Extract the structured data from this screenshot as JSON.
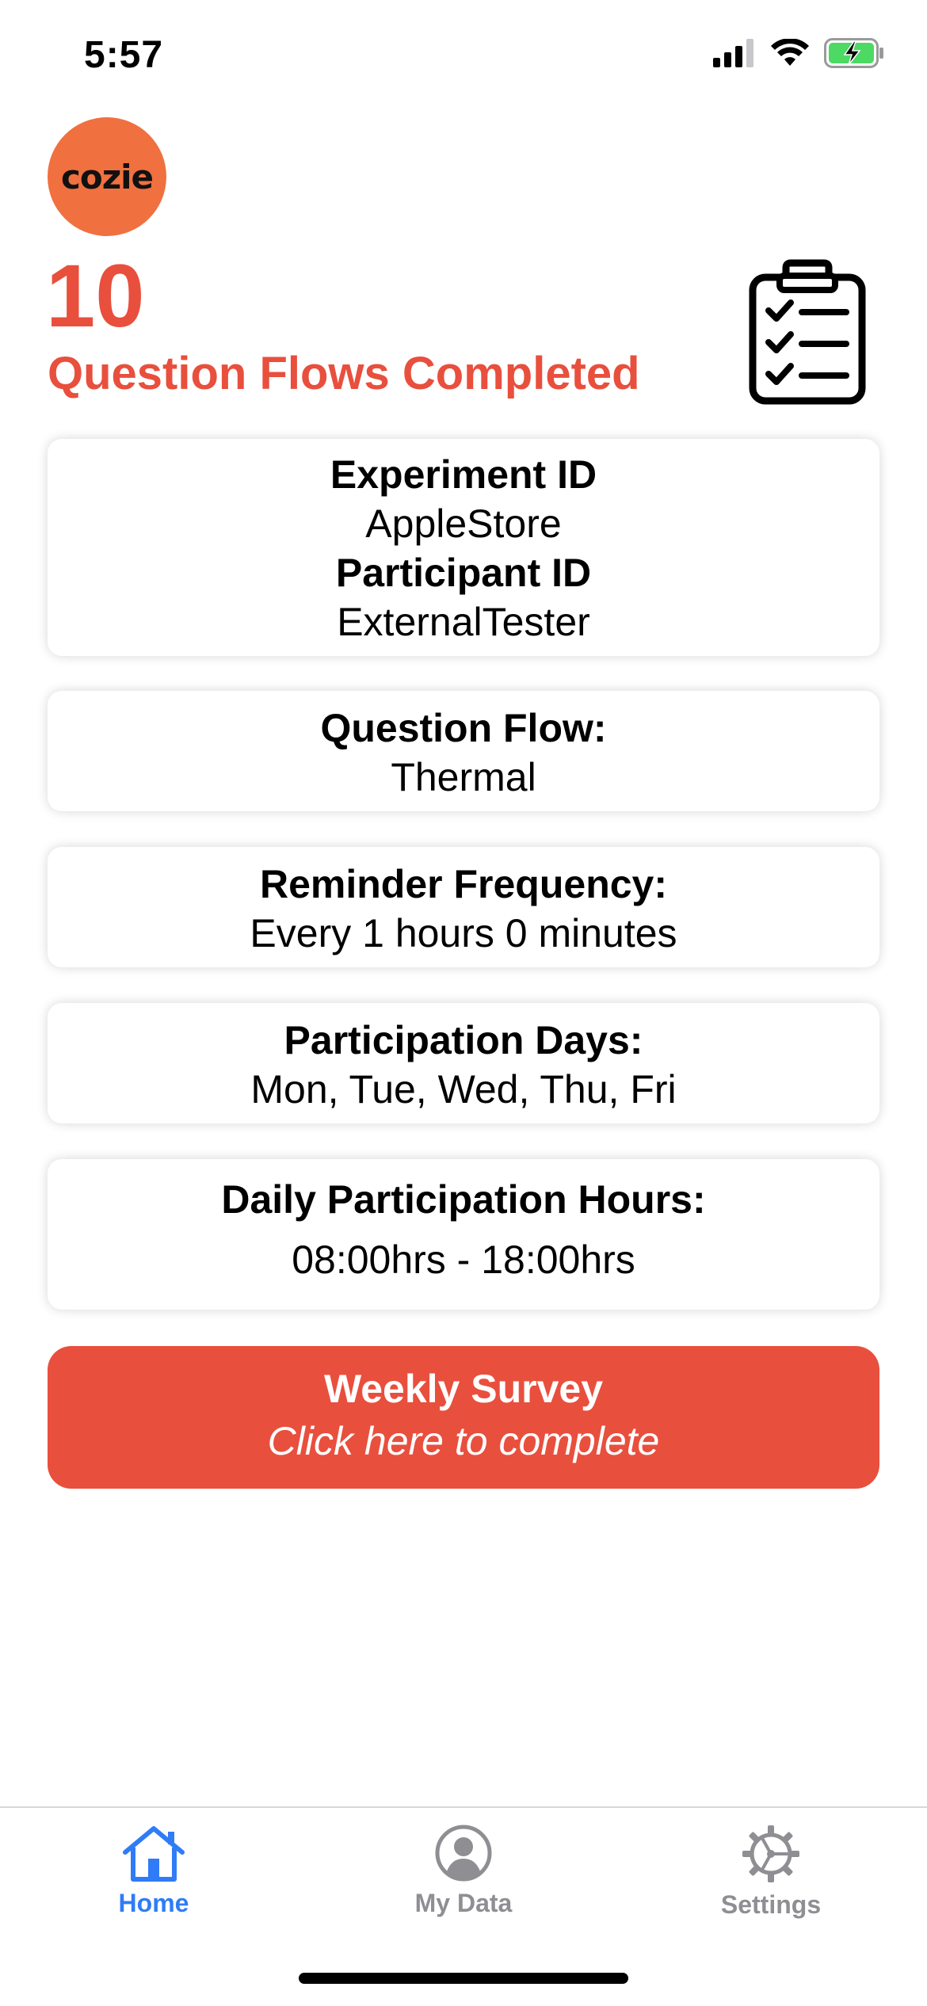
{
  "status_bar": {
    "time": "5:57",
    "icons": [
      "cellular-signal-icon",
      "wifi-icon",
      "battery-charging-icon"
    ]
  },
  "header": {
    "logo_text": "cozie",
    "completed_count": "10",
    "completed_label": "Question Flows Completed",
    "icon": "clipboard-checklist-icon"
  },
  "experiment": {
    "experiment_label": "Experiment ID",
    "experiment_value": "AppleStore",
    "participant_label": "Participant ID",
    "participant_value": "ExternalTester"
  },
  "question_flow": {
    "label": "Question Flow:",
    "value": "Thermal"
  },
  "reminder": {
    "label": "Reminder Frequency:",
    "value": "Every 1 hours 0 minutes"
  },
  "participation_days": {
    "label": "Participation Days:",
    "value": "Mon, Tue, Wed, Thu, Fri"
  },
  "participation_hours": {
    "label": "Daily Participation Hours:",
    "value": "08:00hrs - 18:00hrs"
  },
  "weekly_survey": {
    "title": "Weekly Survey",
    "subtitle": "Click here to complete"
  },
  "tabbar": {
    "tabs": [
      {
        "label": "Home",
        "icon": "home-icon",
        "active": true
      },
      {
        "label": "My Data",
        "icon": "person-circle-icon",
        "active": false
      },
      {
        "label": "Settings",
        "icon": "gear-icon",
        "active": false
      }
    ]
  },
  "colors": {
    "accent": "#e94f3d",
    "logo_bg": "#f07040",
    "tab_active": "#2f7cf6",
    "tab_inactive": "#8e8e93",
    "battery_fill": "#4cd964"
  }
}
